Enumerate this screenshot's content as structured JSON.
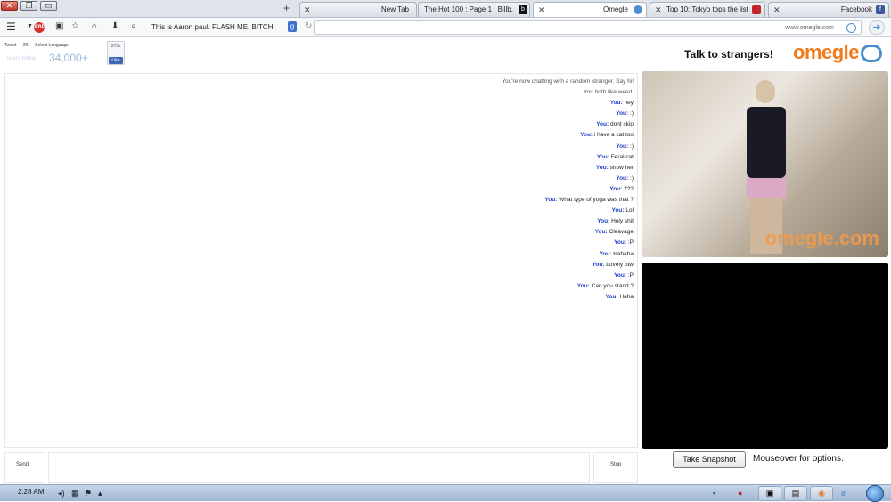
{
  "browser": {
    "tabs": [
      {
        "label": "New Tab"
      },
      {
        "label": "The Hot 100 : Page 1 | Billb..."
      },
      {
        "label": "Omegle"
      },
      {
        "label": "Top 10: Tokyo tops the list ..."
      },
      {
        "label": "Facebook"
      }
    ],
    "window_controls": {
      "close": "✕",
      "max": "❐",
      "min": "▭"
    },
    "new_tab_symbol": "+",
    "search_text": "This is Aaron paul. FLASH ME, BITCH!",
    "url": "www.omegle.com",
    "adblock_badge": "ABP"
  },
  "header": {
    "tagline": "Talk to strangers!",
    "logo_text": "omegle",
    "online_count": "34,000+",
    "online_label": "users online",
    "social": {
      "tweet": "Tweet",
      "tweet_count": "2K",
      "select_language": "Select Language"
    },
    "like_count": "373k",
    "like_label": "Like"
  },
  "chat": {
    "messages": [
      {
        "type": "status",
        "text": "You're now chatting with a random stranger. Say hi!"
      },
      {
        "type": "status",
        "text": "You both like weed."
      },
      {
        "type": "you",
        "who": "You:",
        "text": "hey"
      },
      {
        "type": "you",
        "who": "You:",
        "text": ":)"
      },
      {
        "type": "you",
        "who": "You:",
        "text": "dont skip"
      },
      {
        "type": "you",
        "who": "You:",
        "text": "i have a cat too"
      },
      {
        "type": "you",
        "who": "You:",
        "text": ":)"
      },
      {
        "type": "you",
        "who": "You:",
        "text": "Feral cat"
      },
      {
        "type": "you",
        "who": "You:",
        "text": "show her"
      },
      {
        "type": "you",
        "who": "You:",
        "text": ":)"
      },
      {
        "type": "you",
        "who": "You:",
        "text": "???"
      },
      {
        "type": "you",
        "who": "You:",
        "text": "What type of yoga was that ?"
      },
      {
        "type": "you",
        "who": "You:",
        "text": "Lol"
      },
      {
        "type": "you",
        "who": "You:",
        "text": "Holy shit"
      },
      {
        "type": "you",
        "who": "You:",
        "text": "Cleavage"
      },
      {
        "type": "you",
        "who": "You:",
        "text": ":P"
      },
      {
        "type": "you",
        "who": "You:",
        "text": "Hahaha"
      },
      {
        "type": "you",
        "who": "You:",
        "text": "Lovely btw"
      },
      {
        "type": "you",
        "who": "You:",
        "text": ":P"
      },
      {
        "type": "you",
        "who": "You:",
        "text": "Can you stand ?"
      },
      {
        "type": "you",
        "who": "You:",
        "text": "Haha"
      }
    ],
    "send_label": "Send",
    "stop_label": "Stop"
  },
  "video": {
    "watermark": "omegle.com"
  },
  "controls": {
    "mouseover_text": "Mouseover for options.",
    "snapshot_label": "Take Snapshot"
  },
  "taskbar": {
    "clock": "2:28 AM"
  },
  "colors": {
    "accent_orange": "#f07a1c",
    "accent_blue": "#4c8fd1",
    "you_label": "#1f3fc4"
  }
}
